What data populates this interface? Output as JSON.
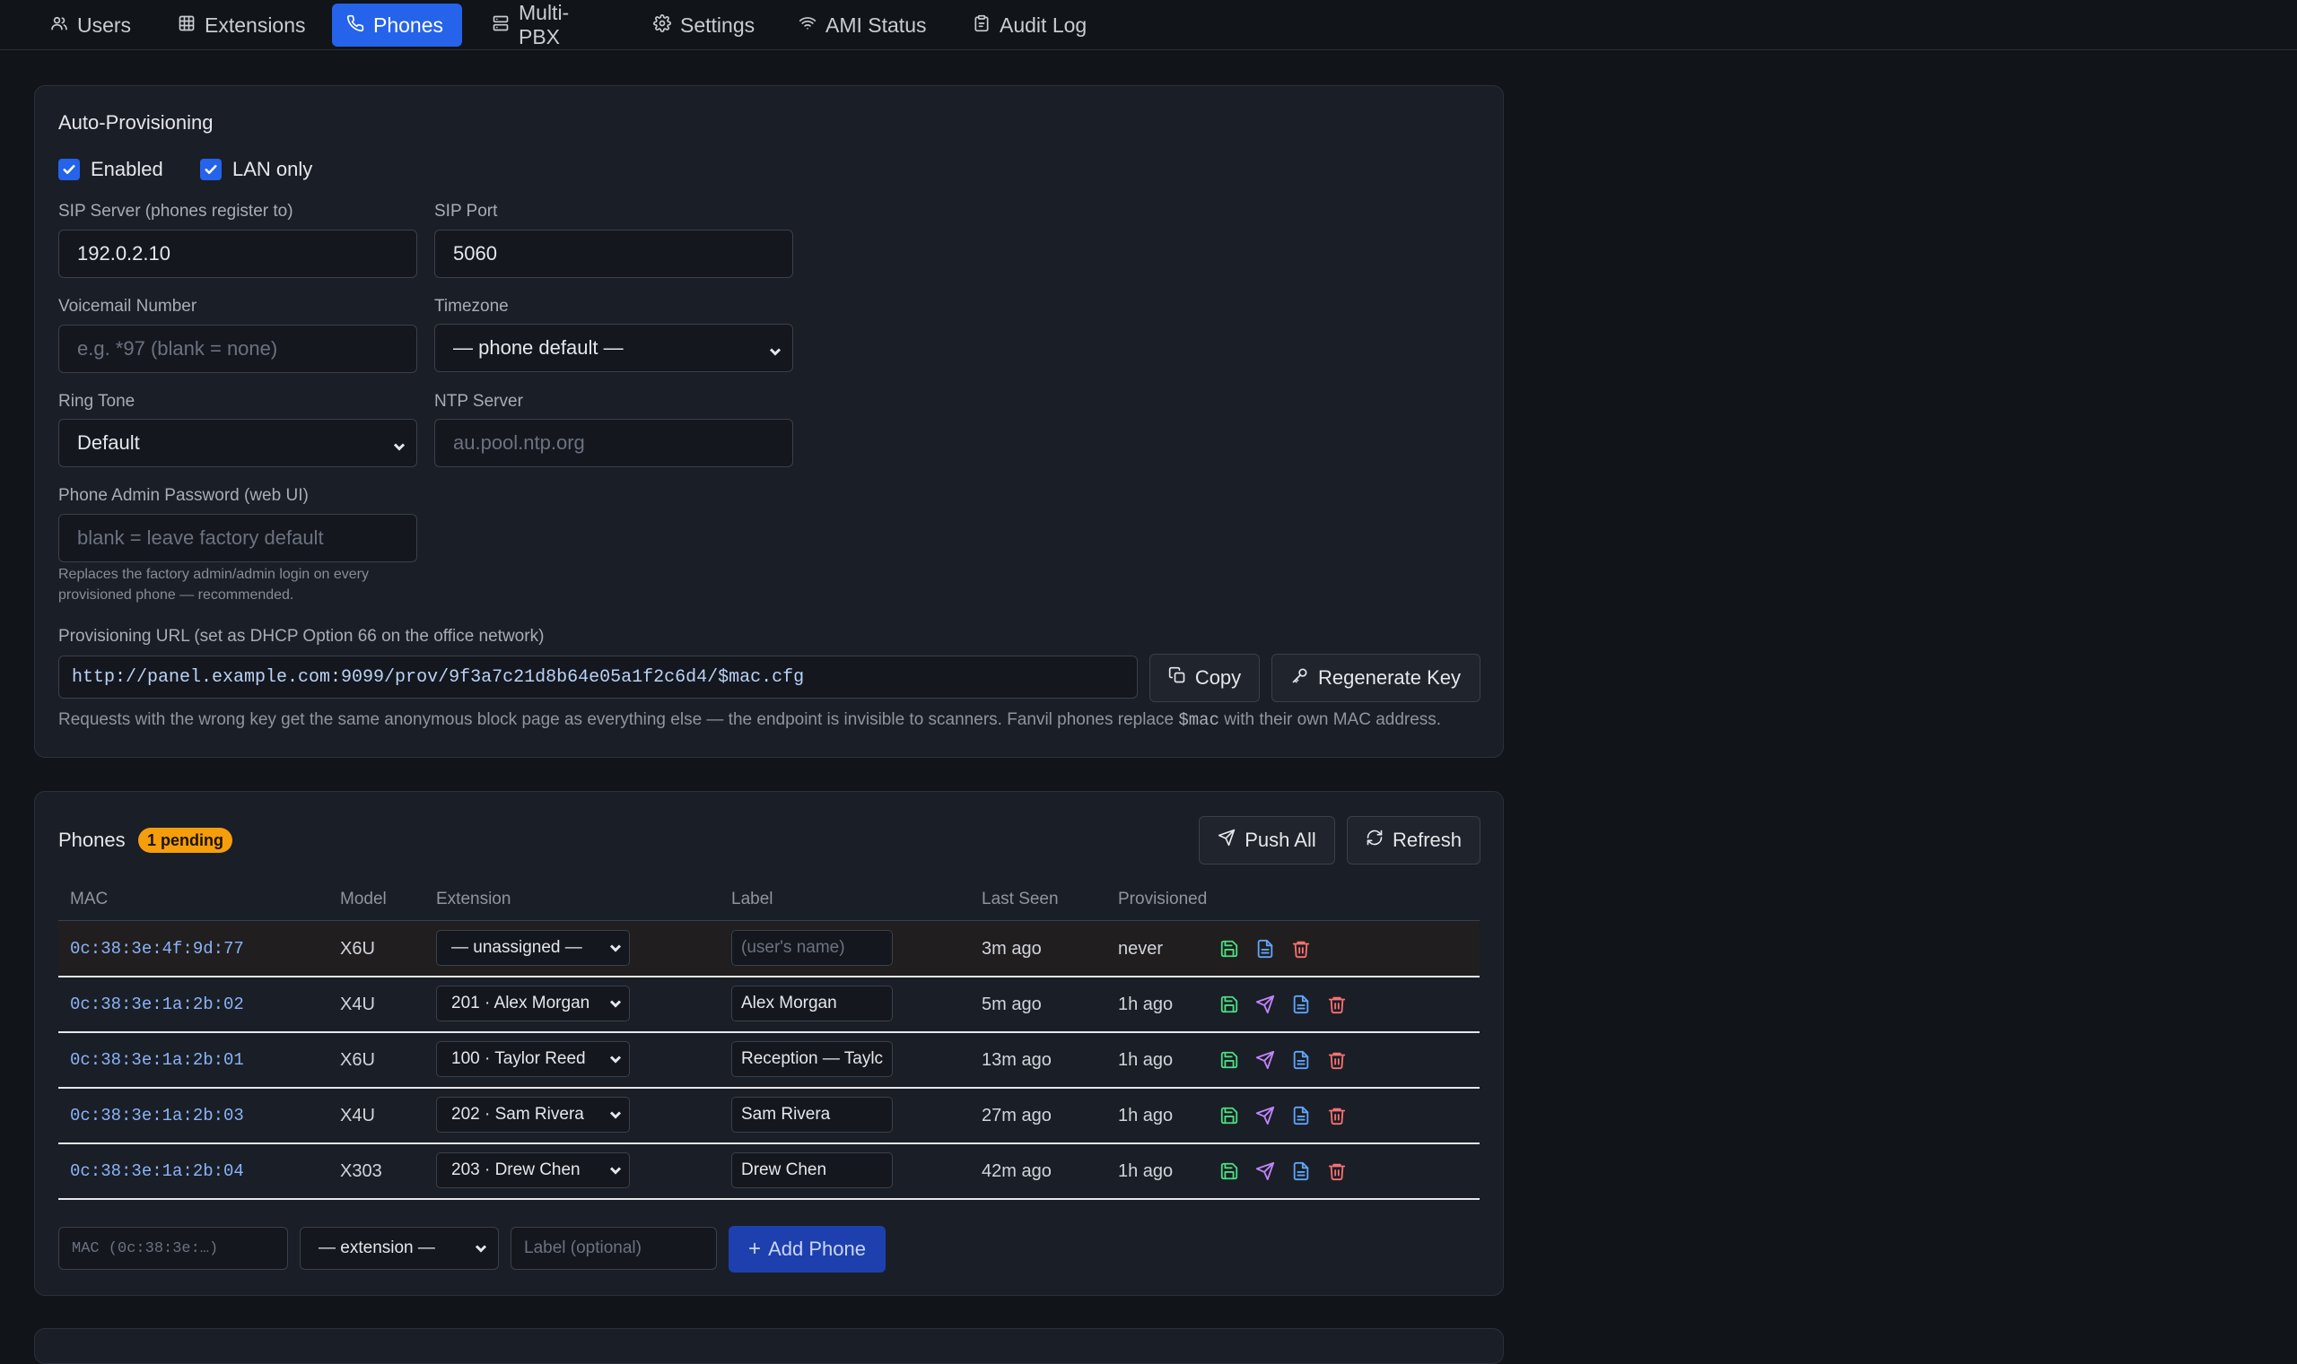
{
  "nav": {
    "tabs": [
      {
        "label": "Users",
        "icon": "users-icon"
      },
      {
        "label": "Extensions",
        "icon": "grid-icon"
      },
      {
        "label": "Phones",
        "icon": "phone-icon"
      },
      {
        "label": "Multi-PBX",
        "icon": "server-icon"
      },
      {
        "label": "Settings",
        "icon": "gear-icon"
      },
      {
        "label": "AMI Status",
        "icon": "wifi-icon"
      },
      {
        "label": "Audit Log",
        "icon": "clipboard-icon"
      }
    ],
    "active": "Phones"
  },
  "provisioning": {
    "title": "Auto-Provisioning",
    "enabled_label": "Enabled",
    "lan_only_label": "LAN only",
    "sip_server_label": "SIP Server (phones register to)",
    "sip_server_value": "192.0.2.10",
    "sip_port_label": "SIP Port",
    "sip_port_value": "5060",
    "voicemail_label": "Voicemail Number",
    "voicemail_placeholder": "e.g. *97 (blank = none)",
    "timezone_label": "Timezone",
    "timezone_value": "— phone default —",
    "ringtone_label": "Ring Tone",
    "ringtone_value": "Default",
    "ntp_label": "NTP Server",
    "ntp_placeholder": "au.pool.ntp.org",
    "admin_pw_label": "Phone Admin Password (web UI)",
    "admin_pw_placeholder": "blank = leave factory default",
    "admin_pw_hint_1": "Replaces the factory admin/admin login on every",
    "admin_pw_hint_2": "provisioned phone — recommended.",
    "url_label": "Provisioning URL (set as DHCP Option 66 on the office network)",
    "url_value": "http://panel.example.com:9099/prov/9f3a7c21d8b64e05a1f2c6d4/$mac.cfg",
    "copy_label": "Copy",
    "regen_label": "Regenerate Key",
    "note_prefix": "Requests with the wrong key get the same anonymous block page as everything else — the endpoint is invisible to scanners. Fanvil phones replace",
    "note_code": "$mac",
    "note_suffix": "with their own MAC address."
  },
  "phones": {
    "title": "Phones",
    "pending_badge": "1 pending",
    "push_all_label": "Push All",
    "refresh_label": "Refresh",
    "columns": {
      "mac": "MAC",
      "model": "Model",
      "extension": "Extension",
      "label": "Label",
      "last_seen": "Last Seen",
      "provisioned": "Provisioned"
    },
    "rows": [
      {
        "mac": "0c:38:3e:4f:9d:77",
        "model": "X6U",
        "extension": "— unassigned —",
        "label": "(user's name)",
        "last_seen": "3m ago",
        "provisioned": "never"
      },
      {
        "mac": "0c:38:3e:1a:2b:02",
        "model": "X4U",
        "extension": "201 · Alex Morgan",
        "label": "Alex Morgan",
        "last_seen": "5m ago",
        "provisioned": "1h ago"
      },
      {
        "mac": "0c:38:3e:1a:2b:01",
        "model": "X6U",
        "extension": "100 · Taylor Reed",
        "label": "Reception — Taylc",
        "last_seen": "13m ago",
        "provisioned": "1h ago"
      },
      {
        "mac": "0c:38:3e:1a:2b:03",
        "model": "X4U",
        "extension": "202 · Sam Rivera",
        "label": "Sam Rivera",
        "last_seen": "27m ago",
        "provisioned": "1h ago"
      },
      {
        "mac": "0c:38:3e:1a:2b:04",
        "model": "X303",
        "extension": "203 · Drew Chen",
        "label": "Drew Chen",
        "last_seen": "42m ago",
        "provisioned": "1h ago"
      }
    ],
    "add": {
      "mac_placeholder": "MAC (0c:38:3e:…)",
      "extension_value": "— extension —",
      "label_placeholder": "Label (optional)",
      "button_label": "Add Phone"
    }
  },
  "colors": {
    "accent": "#2563eb",
    "badge": "#f59e0b",
    "save_icon": "#4ade80",
    "push_icon": "#c084fc",
    "config_icon": "#60a5fa",
    "delete_icon": "#f87171"
  }
}
